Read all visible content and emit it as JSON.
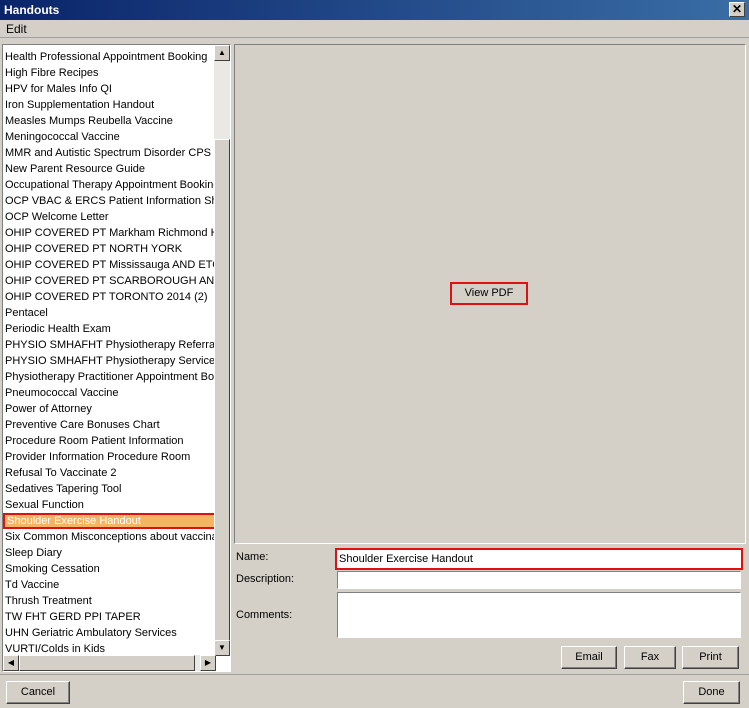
{
  "window": {
    "title": "Handouts",
    "close_glyph": "✕"
  },
  "menu": {
    "edit": "Edit"
  },
  "list": {
    "items": [
      "Health Professional Appointment Booking",
      "High Fibre Recipes",
      "HPV for Males Info QI",
      "Iron Supplementation Handout",
      "Measles Mumps Reubella Vaccine",
      "Meningococcal Vaccine",
      "MMR and Autistic Spectrum Disorder CPS Statement",
      "New Parent Resource Guide",
      "Occupational Therapy Appointment Booking",
      "OCP VBAC & ERCS Patient Information Sheet",
      "OCP Welcome Letter",
      "OHIP COVERED PT  Markham Richmond Hill (",
      "OHIP COVERED PT  NORTH YORK",
      "OHIP COVERED PT Mississauga AND ETOBICOKE",
      "OHIP COVERED PT SCARBOROUGH AND EAST",
      "OHIP COVERED PT TORONTO 2014 (2)",
      "Pentacel",
      "Periodic Health Exam",
      "PHYSIO SMHAFHT Physiotherapy Referral Guide",
      "PHYSIO SMHAFHT Physiotherapy Services R",
      "Physiotherapy Practitioner Appointment Booking",
      "Pneumococcal Vaccine",
      "Power of Attorney",
      "Preventive Care Bonuses Chart",
      "Procedure Room Patient Information",
      "Provider Information Procedure Room",
      "Refusal To Vaccinate 2",
      "Sedatives Tapering Tool",
      "Sexual Function",
      "Shoulder Exercise Handout",
      "Six Common Misconceptions about vaccination",
      "Sleep Diary",
      "Smoking Cessation",
      "Td Vaccine",
      "Thrush Treatment",
      "TW FHT GERD PPI TAPER",
      "UHN Geriatric Ambulatory Services",
      "VURTI/Colds in Kids"
    ],
    "selected": "Shoulder Exercise Handout"
  },
  "preview": {
    "view_pdf_label": "View PDF"
  },
  "details": {
    "name_label": "Name:",
    "name_value": "Shoulder Exercise Handout",
    "description_label": "Description:",
    "description_value": "",
    "comments_label": "Comments:",
    "comments_value": ""
  },
  "actions": {
    "email": "Email",
    "fax": "Fax",
    "print": "Print"
  },
  "footer": {
    "cancel": "Cancel",
    "done": "Done"
  },
  "scroll_icons": {
    "up": "▲",
    "down": "▼",
    "left": "◀",
    "right": "▶"
  }
}
